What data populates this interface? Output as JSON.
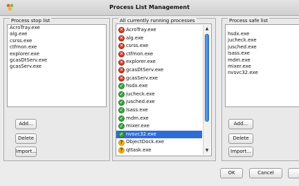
{
  "window": {
    "title": "Process List Management"
  },
  "stop_list": {
    "label": "Process stop list",
    "items": [
      "AcroTray.exe",
      "alg.exe",
      "csrss.exe",
      "ctfmon.exe",
      "explorer.exe",
      "gcasDtServ.exe",
      "gcasServ.exe"
    ],
    "buttons": {
      "add": "Add...",
      "delete": "Delete",
      "import": "Import..."
    }
  },
  "running": {
    "label": "All currently running processes",
    "items": [
      {
        "name": "AcroTray.exe",
        "status": "red"
      },
      {
        "name": "alg.exe",
        "status": "red"
      },
      {
        "name": "csrss.exe",
        "status": "red"
      },
      {
        "name": "ctfmon.exe",
        "status": "red"
      },
      {
        "name": "explorer.exe",
        "status": "red"
      },
      {
        "name": "gcasDtServ.exe",
        "status": "red"
      },
      {
        "name": "gcasServ.exe",
        "status": "red"
      },
      {
        "name": "hsdx.exe",
        "status": "green"
      },
      {
        "name": "jucheck.exe",
        "status": "green"
      },
      {
        "name": "jusched.exe",
        "status": "green"
      },
      {
        "name": "lsass.exe",
        "status": "green"
      },
      {
        "name": "mdm.exe",
        "status": "green"
      },
      {
        "name": "mixer.exe",
        "status": "green"
      },
      {
        "name": "nvsvc32.exe",
        "status": "green",
        "selected": true
      },
      {
        "name": "ObjectDock.exe",
        "status": "yellow"
      },
      {
        "name": "qttask.exe",
        "status": "yellow"
      }
    ],
    "status_icons": {
      "red": "stop-icon",
      "green": "check-icon",
      "yellow": "question-icon"
    },
    "status_colors": {
      "red": "#d23a23",
      "green": "#3ba53b",
      "yellow": "#f2b514",
      "selected": "#2f6dd6"
    }
  },
  "safe_list": {
    "label": "Process safe list",
    "items": [
      "hsdx.exe",
      "jucheck.exe",
      "jusched.exe",
      "lsass.exe",
      "mdm.exe",
      "mixer.exe",
      "nvsvc32.exe"
    ],
    "buttons": {
      "add": "Add...",
      "delete": "Delete",
      "import": "Import..."
    }
  },
  "footer": {
    "ok": "OK",
    "cancel": "Cancel"
  }
}
